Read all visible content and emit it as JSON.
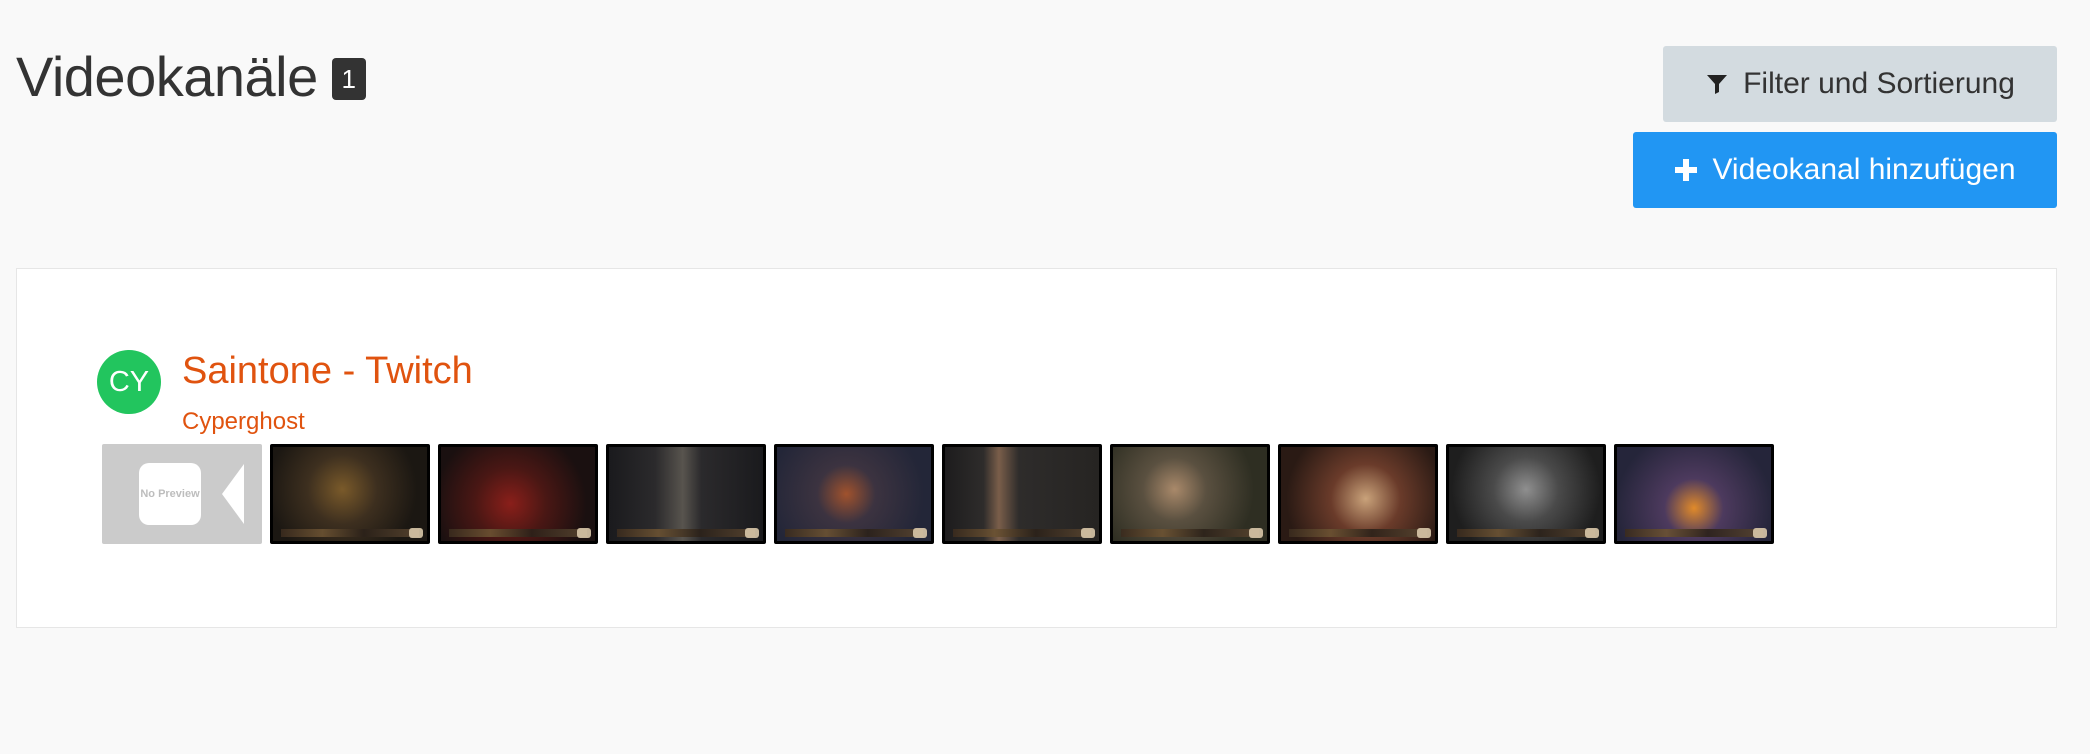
{
  "header": {
    "title": "Videokanäle",
    "count": "1"
  },
  "actions": {
    "filter_label": "Filter und Sortierung",
    "add_label": "Videokanal hinzufügen"
  },
  "channel": {
    "avatar_initials": "CY",
    "avatar_color": "#22c55e",
    "title": "Saintone - Twitch",
    "owner": "Cyperghost",
    "link_color": "#e0530f",
    "no_preview_text": "No Preview",
    "thumbnail_count": 10
  },
  "colors": {
    "primary": "#2196f3",
    "secondary": "#d3dbe0",
    "badge": "#333333"
  }
}
